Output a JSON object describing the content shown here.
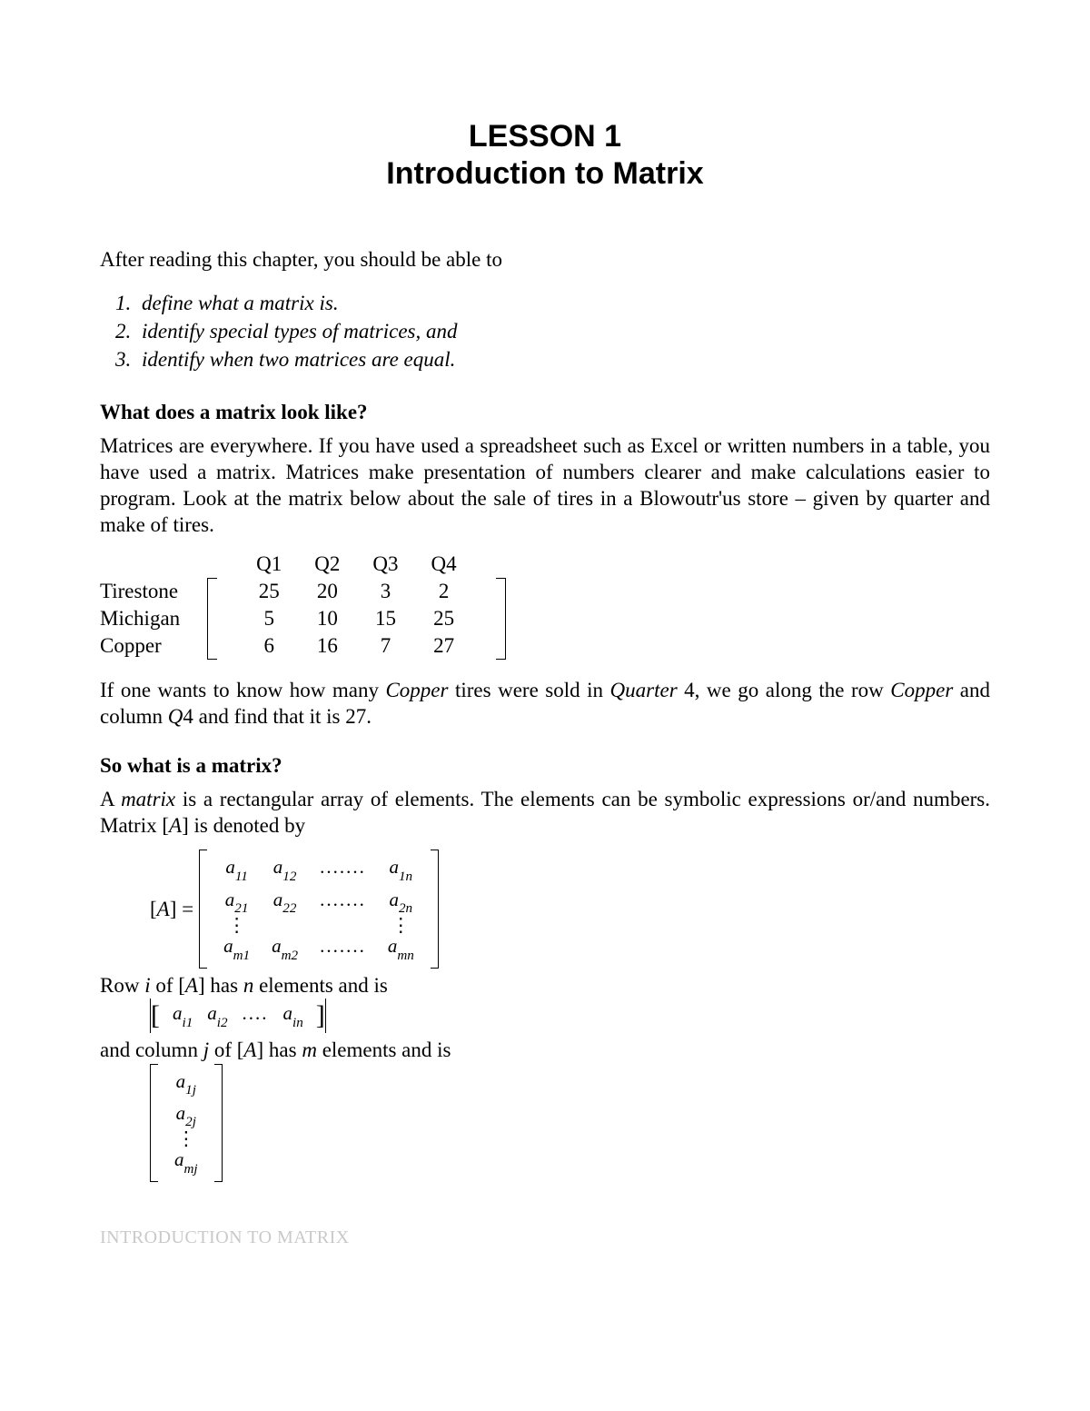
{
  "title": {
    "line1": "LESSON 1",
    "line2": "Introduction to Matrix"
  },
  "intro": "After reading this chapter, you should be able to",
  "objectives": [
    "define what a matrix is.",
    "identify special types of matrices, and",
    "identify when two matrices are equal."
  ],
  "section1": {
    "heading": "What does a matrix look like?",
    "para": "Matrices are everywhere.  If you have used a spreadsheet such as Excel or written numbers in a table, you have used a matrix.   Matrices make presentation of numbers clearer and make calculations easier to program.  Look at the matrix below about the sale of tires in a Blowoutr'us store – given by quarter and make of tires."
  },
  "tire_matrix": {
    "col_headers": [
      "Q1",
      "Q2",
      "Q3",
      "Q4"
    ],
    "rows": [
      {
        "label": "Tirestone",
        "values": [
          25,
          20,
          3,
          2
        ]
      },
      {
        "label": "Michigan",
        "values": [
          5,
          10,
          15,
          25
        ]
      },
      {
        "label": "Copper",
        "values": [
          6,
          16,
          7,
          27
        ]
      }
    ]
  },
  "section1_followup_parts": {
    "a": "If one wants to know how many ",
    "b": "Copper",
    "c": " tires were sold in ",
    "d": "Quarter",
    "e": " 4, we go along the row ",
    "f": "Copper",
    "g": " and column ",
    "h": "Q",
    "i": "4 and find that it is 27."
  },
  "section2": {
    "heading": "So what is a matrix?",
    "para_parts": {
      "a": "A ",
      "b": "matrix",
      "c": " is a rectangular array of elements.  The elements can be symbolic expressions or/and numbers.  Matrix [",
      "d": "A",
      "e": "]  is denoted by"
    }
  },
  "eqn_A_lhs": "[A] =",
  "matrix_A": {
    "r1": [
      "a",
      "11",
      "a",
      "12",
      ".......",
      "a",
      "1n"
    ],
    "r2": [
      "a",
      "21",
      "a",
      "22",
      ".......",
      "a",
      "2n"
    ],
    "r4": [
      "a",
      "m1",
      "a",
      "m2",
      ".......",
      "a",
      "mn"
    ]
  },
  "row_text_parts": {
    "a": "Row ",
    "b": "i ",
    "c": "of [",
    "d": "A",
    "e": "]  has  ",
    "f": "n",
    "g": "  elements and is"
  },
  "row_vector": [
    "a",
    "i1",
    "a",
    "i2",
    "....",
    "a",
    "in"
  ],
  "col_text_parts": {
    "a": "and column  ",
    "b": "j",
    "c": "  of [",
    "d": "A",
    "e": "]  has  ",
    "f": "m",
    "g": "  elements and is"
  },
  "col_vector": [
    [
      "a",
      "1j"
    ],
    [
      "a",
      "2j"
    ],
    [
      "a",
      "mj"
    ]
  ],
  "footer": "INTRODUCTION TO MATRIX"
}
